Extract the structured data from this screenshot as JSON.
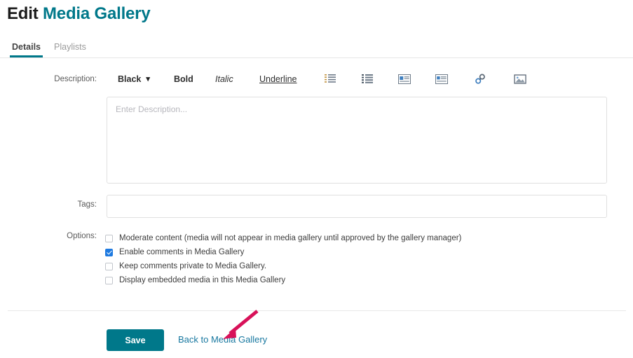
{
  "page": {
    "title_prefix": "Edit",
    "title_main": "Media Gallery"
  },
  "tabs": [
    {
      "label": "Details",
      "active": true
    },
    {
      "label": "Playlists",
      "active": false
    }
  ],
  "form": {
    "description": {
      "label": "Description:",
      "value": "",
      "placeholder": "Enter Description..."
    },
    "tags": {
      "label": "Tags:",
      "value": "",
      "placeholder": ""
    },
    "options": {
      "label": "Options:",
      "items": [
        {
          "label": "Moderate content (media will not appear in media gallery until approved by the gallery manager)",
          "checked": false
        },
        {
          "label": "Enable comments in Media Gallery",
          "checked": true
        },
        {
          "label": "Keep comments private to Media Gallery.",
          "checked": false
        },
        {
          "label": "Display embedded media in this Media Gallery",
          "checked": false
        }
      ]
    }
  },
  "toolbar": {
    "color_label": "Black",
    "caret": "▾",
    "bold_label": "Bold",
    "italic_label": "Italic",
    "underline_label": "Underline",
    "icons": [
      "numbered-list-icon",
      "bulleted-list-icon",
      "align-left-image-icon",
      "align-right-image-icon",
      "link-icon",
      "insert-image-icon"
    ]
  },
  "footer": {
    "save_label": "Save",
    "back_label": "Back to Media Gallery"
  },
  "annotation": {
    "type": "arrow",
    "color": "#d81159",
    "points_to": "back-to-media-gallery-link"
  },
  "colors": {
    "brand_teal": "#00788a",
    "link_blue": "#1878a0",
    "checkbox_blue": "#1e7ae0",
    "annotation_pink": "#d81159",
    "border_gray": "#e0e0e0"
  }
}
